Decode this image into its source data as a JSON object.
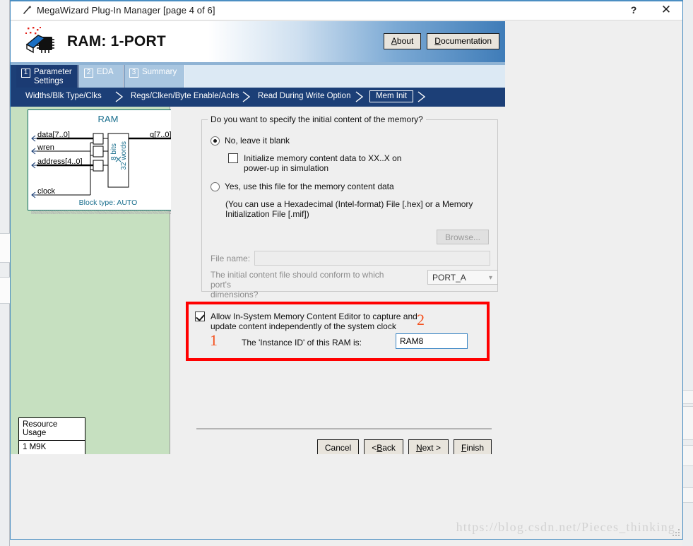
{
  "window": {
    "title": "MegaWizard Plug-In Manager [page 4 of 6]",
    "title_icon": "wizard-wand-icon",
    "help_label": "?",
    "close_label": "✕"
  },
  "banner": {
    "title": "RAM: 1-PORT",
    "logo_icon": "megawizard-chip-icon",
    "about_label": "About",
    "about_mnemonic": "A",
    "documentation_label": "Documentation",
    "documentation_mnemonic": "D"
  },
  "tabs": [
    {
      "num": "1",
      "label_line1": "Parameter",
      "label_line2": "Settings",
      "active": true
    },
    {
      "num": "2",
      "label_line1": "EDA",
      "label_line2": "",
      "active": false
    },
    {
      "num": "3",
      "label_line1": "Summary",
      "label_line2": "",
      "active": false
    }
  ],
  "breadcrumbs": [
    {
      "label": "Widths/Blk Type/Clks",
      "current": false
    },
    {
      "label": "Regs/Clken/Byte Enable/Aclrs",
      "current": false
    },
    {
      "label": "Read During Write Option",
      "current": false
    },
    {
      "label": "Mem Init",
      "current": true
    }
  ],
  "diagram": {
    "title": "RAM",
    "inputs": [
      "data[7..0]",
      "wren",
      "address[4..0]",
      "clock"
    ],
    "output": "q[7..0]",
    "mem_bits": "8 bits",
    "mem_words": "32 words",
    "block_type": "Block type: AUTO"
  },
  "resource_usage": {
    "header": "Resource Usage",
    "value": "1 M9K"
  },
  "main": {
    "group_title": "Do you want to specify the initial content of the memory?",
    "option_no": "No, leave it blank",
    "option_no_selected": true,
    "init_xx_line1": "Initialize memory content data to XX..X on",
    "init_xx_line2": "power-up in simulation",
    "init_xx_checked": false,
    "option_yes": "Yes, use this file for the memory content data",
    "option_yes_selected": false,
    "hint_line1": "(You can use a Hexadecimal (Intel-format) File [.hex] or a Memory",
    "hint_line2": "Initialization File [.mif])",
    "browse_label": "Browse...",
    "filename_label": "File name:",
    "filename_value": "",
    "filename_placeholder": "",
    "conform_line1": "The initial content file should conform to which port's",
    "conform_line2": "dimensions?",
    "port_selected": "PORT_A",
    "port_options": [
      "PORT_A"
    ]
  },
  "highlight": {
    "isme_line1": "Allow In-System Memory Content Editor to capture and",
    "isme_line2": "update content independently of the system clock",
    "isme_checked": true,
    "instance_id_label": "The 'Instance ID' of this RAM is:",
    "instance_id_value": "RAM8",
    "annotation_1": "1",
    "annotation_2": "2",
    "box_color": "#ff0000",
    "annotation_color": "#f4511e"
  },
  "footer": {
    "cancel_label": "Cancel",
    "back_label": "< Back",
    "back_mnemonic": "B",
    "next_label": "Next >",
    "next_mnemonic": "N",
    "finish_label": "Finish",
    "finish_mnemonic": "F"
  },
  "watermark": "https://blog.csdn.net/Pieces_thinking"
}
